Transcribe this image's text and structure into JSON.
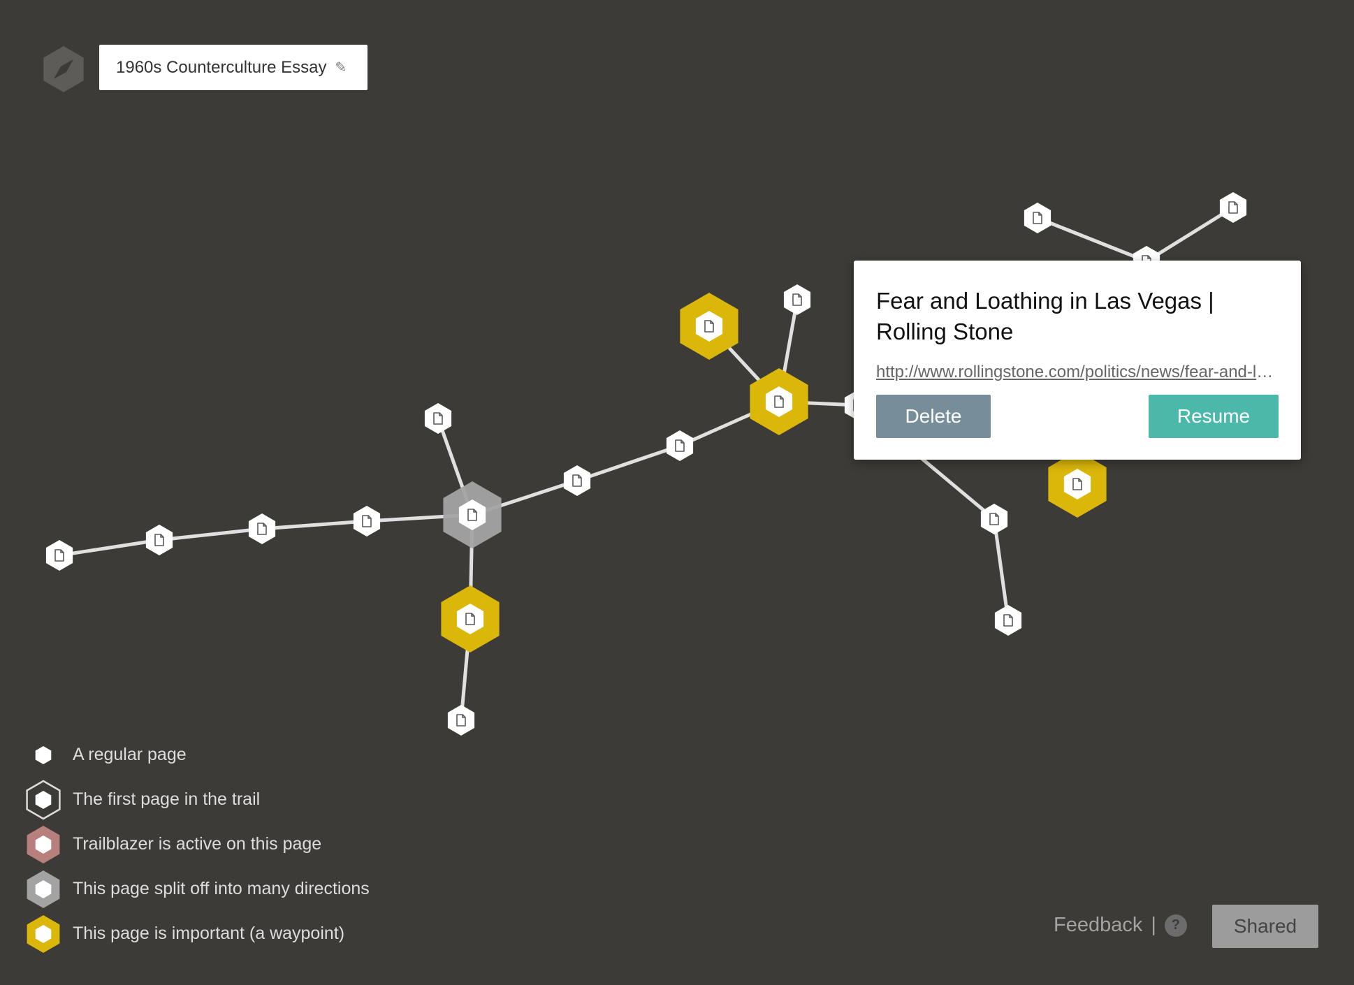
{
  "header": {
    "trail_title": "1960s Counterculture Essay",
    "logo_icon": "compass-icon",
    "edit_icon": "pencil-icon"
  },
  "popup": {
    "title": "Fear and Loathing in Las Vegas | Rolling Stone",
    "url": "http://www.rollingstone.com/politics/news/fear-and-loathing-in-las-vegas",
    "delete_label": "Delete",
    "resume_label": "Resume"
  },
  "legend": {
    "items": [
      {
        "kind": "regular",
        "label": "A regular page"
      },
      {
        "kind": "first",
        "label": "The first page in the trail"
      },
      {
        "kind": "active",
        "label": "Trailblazer is active on this page"
      },
      {
        "kind": "split",
        "label": "This page split off into many directions"
      },
      {
        "kind": "waypoint",
        "label": "This page is important (a waypoint)"
      }
    ]
  },
  "footer": {
    "feedback_label": "Feedback",
    "separator": "|",
    "help_label": "?",
    "shared_label": "Shared"
  },
  "node_icon": "document-icon",
  "colors": {
    "background": "#3d3b37",
    "waypoint": "#dbb70a",
    "split": "#a3a3a3",
    "active": "#b8807c",
    "link": "#e0e0e0",
    "resume": "#4bb8a9",
    "delete": "#778d99"
  }
}
